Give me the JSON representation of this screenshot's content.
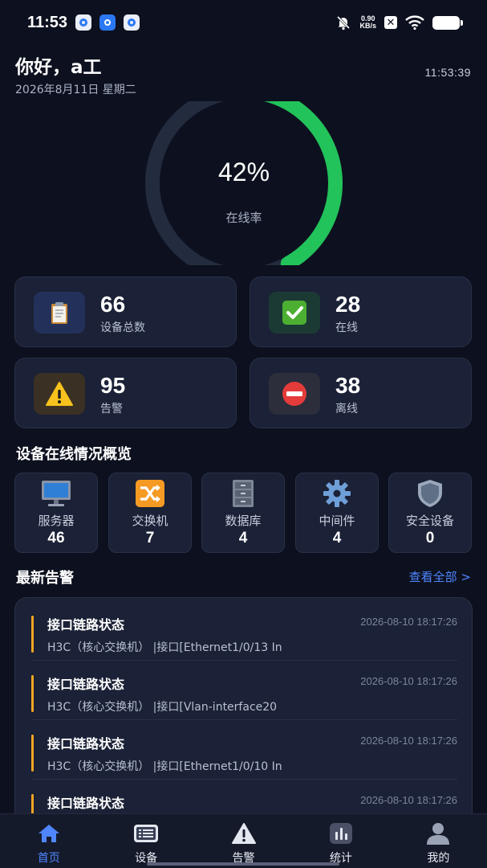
{
  "status_bar": {
    "time": "11:53",
    "net_speed_value": "0.90",
    "net_speed_unit": "KB/s"
  },
  "header": {
    "greeting": "你好，a工",
    "date": "2026年8月11日 星期二",
    "clock": "11:53:39"
  },
  "gauge": {
    "value_text": "42%",
    "fraction": 0.42,
    "label": "在线率",
    "track_color": "#232b3e",
    "fill_color": "#22c35a"
  },
  "stats": [
    {
      "value": "66",
      "label": "设备总数",
      "icon": "clipboard-icon",
      "icon_bg": "#23315a"
    },
    {
      "value": "28",
      "label": "在线",
      "icon": "check-icon",
      "icon_bg": "#1c3a34"
    },
    {
      "value": "95",
      "label": "告警",
      "icon": "warning-icon",
      "icon_bg": "#3a3024"
    },
    {
      "value": "38",
      "label": "离线",
      "icon": "no-entry-icon",
      "icon_bg": "#2c2e3c"
    }
  ],
  "overview": {
    "title": "设备在线情况概览",
    "categories": [
      {
        "name": "服务器",
        "count": "46",
        "icon": "monitor-icon"
      },
      {
        "name": "交换机",
        "count": "7",
        "icon": "shuffle-icon"
      },
      {
        "name": "数据库",
        "count": "4",
        "icon": "cabinet-icon"
      },
      {
        "name": "中间件",
        "count": "4",
        "icon": "gear-icon"
      },
      {
        "name": "安全设备",
        "count": "0",
        "icon": "shield-icon"
      }
    ]
  },
  "alerts": {
    "title": "最新告警",
    "view_all": "查看全部 >",
    "accent": "#f5a623",
    "items": [
      {
        "title": "接口链路状态",
        "time": "2026-08-10 18:17:26",
        "desc": "H3C（核心交换机） |接口[Ethernet1/0/13 In"
      },
      {
        "title": "接口链路状态",
        "time": "2026-08-10 18:17:26",
        "desc": "H3C（核心交换机） |接口[Vlan-interface20"
      },
      {
        "title": "接口链路状态",
        "time": "2026-08-10 18:17:26",
        "desc": "H3C（核心交换机） |接口[Ethernet1/0/10 In"
      },
      {
        "title": "接口链路状态",
        "time": "2026-08-10 18:17:26",
        "desc": ""
      }
    ]
  },
  "nav": {
    "active_color": "#4f86ff",
    "items": [
      {
        "label": "首页",
        "icon": "home-icon",
        "active": true
      },
      {
        "label": "设备",
        "icon": "device-list-icon",
        "active": false
      },
      {
        "label": "告警",
        "icon": "alert-icon",
        "active": false
      },
      {
        "label": "统计",
        "icon": "stats-icon",
        "active": false
      },
      {
        "label": "我的",
        "icon": "user-icon",
        "active": false
      }
    ]
  }
}
